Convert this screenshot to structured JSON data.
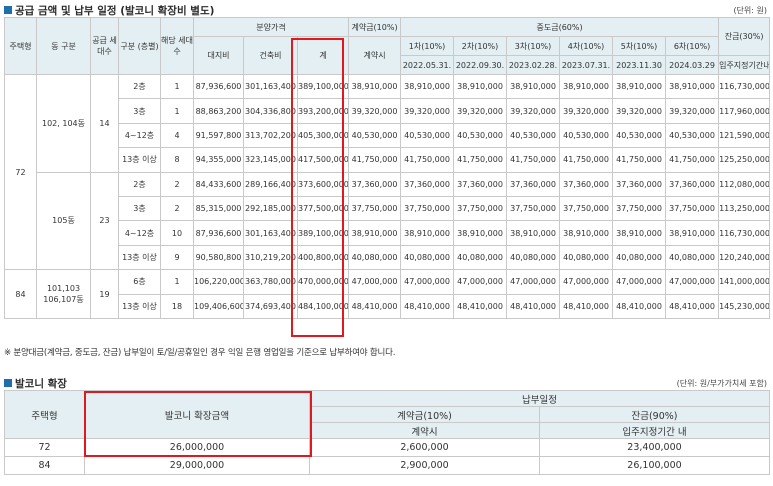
{
  "section1": {
    "title": "공급 금액 및 납부 일정 (발코니 확장비 별도)",
    "unit": "(단위: 원)"
  },
  "table1": {
    "headers": {
      "type": "주택형",
      "dong": "동 구분",
      "households": "공급 세대수",
      "floor": "구분 (층별)",
      "floor_households": "해당 세대수",
      "sale_price": "분양가격",
      "land": "대지비",
      "building": "건축비",
      "total": "계",
      "contract": "계약금(10%)",
      "contract_sub": "계약시",
      "middle": "중도금(60%)",
      "middle_cols": [
        {
          "label": "1차(10%)",
          "date": "2022.05.31."
        },
        {
          "label": "2차(10%)",
          "date": "2022.09.30."
        },
        {
          "label": "3차(10%)",
          "date": "2023.02.28."
        },
        {
          "label": "4차(10%)",
          "date": "2023.07.31."
        },
        {
          "label": "5차(10%)",
          "date": "2023.11.30"
        },
        {
          "label": "6차(10%)",
          "date": "2024.03.29"
        }
      ],
      "balance": "잔금(30%)",
      "balance_sub": "입주지정기간내"
    },
    "groups": [
      {
        "type": "72",
        "dong": "102, 104동",
        "households": "14",
        "rows": [
          {
            "floor": "2층",
            "n": "1",
            "land": "87,936,600",
            "building": "301,163,400",
            "total": "389,100,000",
            "contract": "38,910,000",
            "middle": [
              "38,910,000",
              "38,910,000",
              "38,910,000",
              "38,910,000",
              "38,910,000",
              "38,910,000"
            ],
            "balance": "116,730,000"
          },
          {
            "floor": "3층",
            "n": "1",
            "land": "88,863,200",
            "building": "304,336,800",
            "total": "393,200,000",
            "contract": "39,320,000",
            "middle": [
              "39,320,000",
              "39,320,000",
              "39,320,000",
              "39,320,000",
              "39,320,000",
              "39,320,000"
            ],
            "balance": "117,960,000"
          },
          {
            "floor": "4~12층",
            "n": "4",
            "land": "91,597,800",
            "building": "313,702,200",
            "total": "405,300,000",
            "contract": "40,530,000",
            "middle": [
              "40,530,000",
              "40,530,000",
              "40,530,000",
              "40,530,000",
              "40,530,000",
              "40,530,000"
            ],
            "balance": "121,590,000"
          },
          {
            "floor": "13층 이상",
            "n": "8",
            "land": "94,355,000",
            "building": "323,145,000",
            "total": "417,500,000",
            "contract": "41,750,000",
            "middle": [
              "41,750,000",
              "41,750,000",
              "41,750,000",
              "41,750,000",
              "41,750,000",
              "41,750,000"
            ],
            "balance": "125,250,000"
          }
        ]
      },
      {
        "type": "72",
        "dong": "105동",
        "households": "23",
        "rows": [
          {
            "floor": "2층",
            "n": "2",
            "land": "84,433,600",
            "building": "289,166,400",
            "total": "373,600,000",
            "contract": "37,360,000",
            "middle": [
              "37,360,000",
              "37,360,000",
              "37,360,000",
              "37,360,000",
              "37,360,000",
              "37,360,000"
            ],
            "balance": "112,080,000"
          },
          {
            "floor": "3층",
            "n": "2",
            "land": "85,315,000",
            "building": "292,185,000",
            "total": "377,500,000",
            "contract": "37,750,000",
            "middle": [
              "37,750,000",
              "37,750,000",
              "37,750,000",
              "37,750,000",
              "37,750,000",
              "37,750,000"
            ],
            "balance": "113,250,000"
          },
          {
            "floor": "4~12층",
            "n": "10",
            "land": "87,936,600",
            "building": "301,163,400",
            "total": "389,100,000",
            "contract": "38,910,000",
            "middle": [
              "38,910,000",
              "38,910,000",
              "38,910,000",
              "38,910,000",
              "38,910,000",
              "38,910,000"
            ],
            "balance": "116,730,000"
          },
          {
            "floor": "13층 이상",
            "n": "9",
            "land": "90,580,800",
            "building": "310,219,200",
            "total": "400,800,000",
            "contract": "40,080,000",
            "middle": [
              "40,080,000",
              "40,080,000",
              "40,080,000",
              "40,080,000",
              "40,080,000",
              "40,080,000"
            ],
            "balance": "120,240,000"
          }
        ]
      },
      {
        "type": "84",
        "dong": "101,103 106,107동",
        "households": "19",
        "rows": [
          {
            "floor": "6층",
            "n": "1",
            "land": "106,220,000",
            "building": "363,780,000",
            "total": "470,000,000",
            "contract": "47,000,000",
            "middle": [
              "47,000,000",
              "47,000,000",
              "47,000,000",
              "47,000,000",
              "47,000,000",
              "47,000,000"
            ],
            "balance": "141,000,000"
          },
          {
            "floor": "13층 이상",
            "n": "18",
            "land": "109,406,600",
            "building": "374,693,400",
            "total": "484,100,000",
            "contract": "48,410,000",
            "middle": [
              "48,410,000",
              "48,410,000",
              "48,410,000",
              "48,410,000",
              "48,410,000",
              "48,410,000"
            ],
            "balance": "145,230,000"
          }
        ]
      }
    ]
  },
  "note": "※ 분양대금(계약금, 중도금, 잔금) 납부일이 토/일/공휴일인 경우 익일 은행 영업일을 기준으로 납부하여야 합니다.",
  "section2": {
    "title": "발코니 확장",
    "unit": "(단위: 원/부가가치세 포함)"
  },
  "table2": {
    "headers": {
      "type": "주택형",
      "amount": "발코니 확장금액",
      "schedule": "납부일정",
      "contract": "계약금(10%)",
      "contract_sub": "계약시",
      "balance": "잔금(90%)",
      "balance_sub": "입주지정기간 내"
    },
    "rows": [
      {
        "type": "72",
        "amount": "26,000,000",
        "contract": "2,600,000",
        "balance": "23,400,000"
      },
      {
        "type": "84",
        "amount": "29,000,000",
        "contract": "2,900,000",
        "balance": "26,100,000"
      }
    ]
  },
  "colors": {
    "accent": "#1f6fa8",
    "header_bg": "#e3eff3",
    "highlight": "#e0181f"
  }
}
